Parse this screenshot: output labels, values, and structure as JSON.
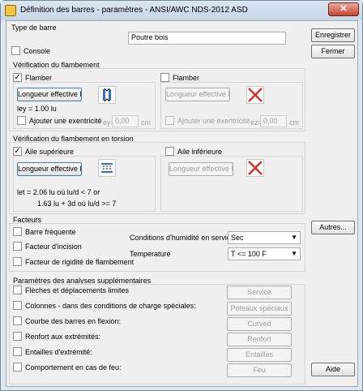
{
  "window": {
    "title": "Définition des barres - paramètres - ANSI/AWC NDS-2012 ASD",
    "close_label": "✕"
  },
  "type_barre": {
    "title": "Type de barre",
    "name_value": "Poutre bois",
    "console_label": "Console",
    "console_checked": false
  },
  "buttons": {
    "save": "Enregistrer",
    "close": "Fermer",
    "more": "Autres...",
    "help": "Aide"
  },
  "flambement": {
    "title": "Vérification du flambement",
    "left": {
      "flamber_label": "Flamber",
      "flamber_checked": true,
      "length_button": "Longueur effective ley",
      "length_value": "ley = 1.00 lu",
      "eccentricity_label": "Ajouter une exentricité",
      "ecc_prefix": "ey=",
      "ecc_value": "0,00",
      "ecc_unit": "cm"
    },
    "right": {
      "flamber_label": "Flamber",
      "flamber_checked": false,
      "length_button": "Longueur effective lez",
      "eccentricity_label": "Ajouter une exentricité",
      "ecc_prefix": "ez=",
      "ecc_value": "0,00",
      "ecc_unit": "cm"
    }
  },
  "torsion": {
    "title": "Vérification du flambement en torsion",
    "top": {
      "label": "Aile supérieure",
      "checked": true,
      "length_button": "Longueur effective let",
      "formula_line1": "let = 2.06 lu  où lu/d < 7  or",
      "formula_line2": "1.63 lu + 3d  où lu/d >= 7"
    },
    "bottom": {
      "label": "Aile inférieure",
      "checked": false,
      "length_button": "Longueur effective leb"
    }
  },
  "facteurs": {
    "title": "Facteurs",
    "items": [
      {
        "label": "Barre fréquente",
        "checked": false
      },
      {
        "label": "Facteur d'incision",
        "checked": false
      },
      {
        "label": "Facteur de rigidité de flambement",
        "checked": false
      }
    ],
    "humidity_label": "Conditions d'humidité en service",
    "humidity_value": "Sec",
    "temperature_label": "Temperature",
    "temperature_value": "T <= 100 F"
  },
  "analyses": {
    "title": "Paramètres des analyses supplémentaires",
    "items": [
      {
        "label": "Flèches et déplacements limites",
        "button": "Service"
      },
      {
        "label": "Colonnes - dans des conditions de charge spéciales:",
        "button": "Poteaux spéciaux"
      },
      {
        "label": "Courbe des barres en flexion:",
        "button": "Curved"
      },
      {
        "label": "Renfort aux extrémités:",
        "button": "Renfort"
      },
      {
        "label": "Entailles d'extrémité:",
        "button": "Entailles"
      },
      {
        "label": "Comportement en cas de feu:",
        "button": "Feu"
      }
    ]
  },
  "icons": {
    "app": "app-icon",
    "column_buckling": "column-buckling-icon",
    "lateral_torsion": "lateral-torsion-icon",
    "disabled_cross": "disabled-cross-icon"
  },
  "colors": {
    "cross_red": "#d8312b",
    "focus_blue": "#3c7fb1"
  }
}
